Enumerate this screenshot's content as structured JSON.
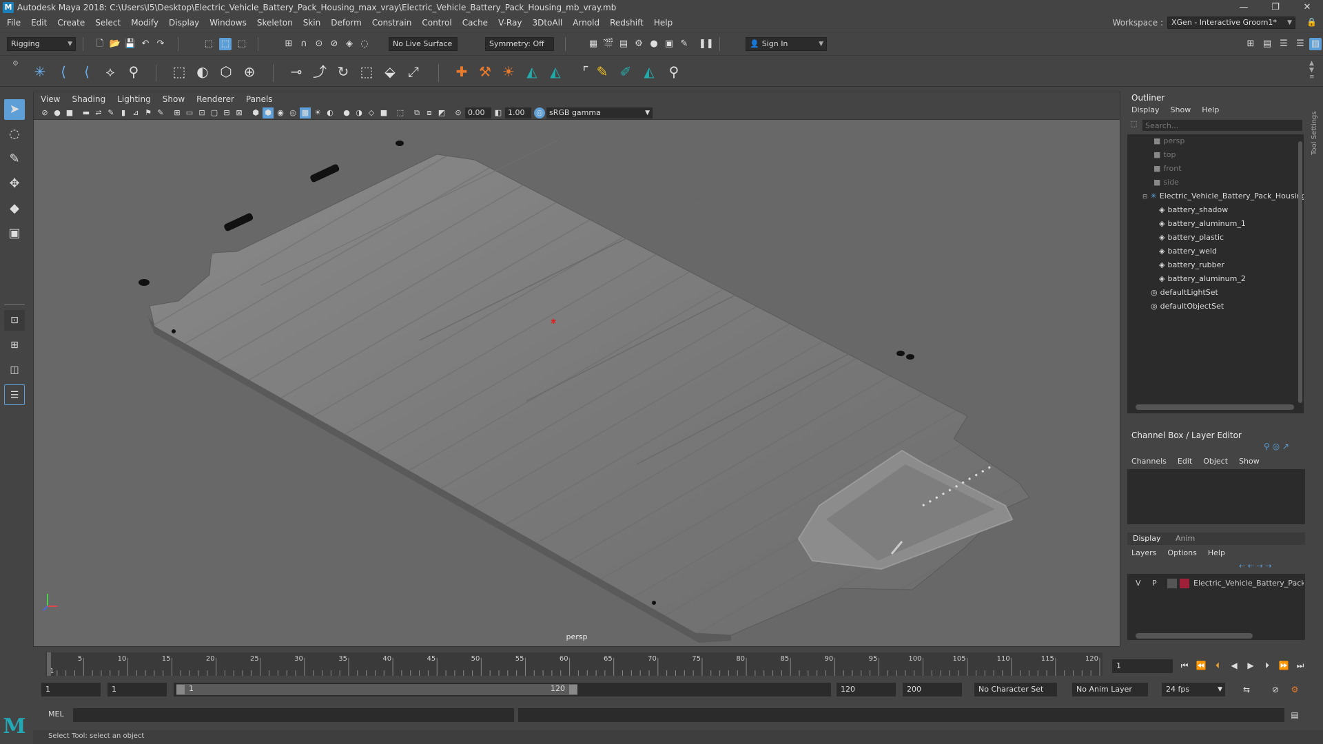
{
  "window": {
    "title": "Autodesk Maya 2018: C:\\Users\\I5\\Desktop\\Electric_Vehicle_Battery_Pack_Housing_max_vray\\Electric_Vehicle_Battery_Pack_Housing_mb_vray.mb",
    "app_icon": "M"
  },
  "menubar": [
    "File",
    "Edit",
    "Create",
    "Select",
    "Modify",
    "Display",
    "Windows",
    "Skeleton",
    "Skin",
    "Deform",
    "Constrain",
    "Control",
    "Cache",
    "V-Ray",
    "3DtoAll",
    "Arnold",
    "Redshift",
    "Help"
  ],
  "workspace": {
    "label": "Workspace :",
    "value": "XGen - Interactive Groom1*"
  },
  "statusline": {
    "mode": "Rigging",
    "live_surface": "No Live Surface",
    "symmetry": "Symmetry: Off",
    "sign_in": "Sign In"
  },
  "viewport": {
    "menus": [
      "View",
      "Shading",
      "Lighting",
      "Show",
      "Renderer",
      "Panels"
    ],
    "exposure": "0.00",
    "gamma": "1.00",
    "colorspace": "sRGB gamma",
    "camera": "persp"
  },
  "outliner": {
    "title": "Outliner",
    "menus": [
      "Display",
      "Show",
      "Help"
    ],
    "search_placeholder": "Search...",
    "items": [
      {
        "label": "persp",
        "type": "camera",
        "dim": true,
        "indent": 1
      },
      {
        "label": "top",
        "type": "camera",
        "dim": true,
        "indent": 1
      },
      {
        "label": "front",
        "type": "camera",
        "dim": true,
        "indent": 1
      },
      {
        "label": "side",
        "type": "camera",
        "dim": true,
        "indent": 1
      },
      {
        "label": "Electric_Vehicle_Battery_Pack_Housing",
        "type": "group",
        "dim": false,
        "indent": 0
      },
      {
        "label": "battery_shadow",
        "type": "mesh",
        "dim": false,
        "indent": 2
      },
      {
        "label": "battery_aluminum_1",
        "type": "mesh",
        "dim": false,
        "indent": 2
      },
      {
        "label": "battery_plastic",
        "type": "mesh",
        "dim": false,
        "indent": 2
      },
      {
        "label": "battery_weld",
        "type": "mesh",
        "dim": false,
        "indent": 2
      },
      {
        "label": "battery_rubber",
        "type": "mesh",
        "dim": false,
        "indent": 2
      },
      {
        "label": "battery_aluminum_2",
        "type": "mesh",
        "dim": false,
        "indent": 2
      },
      {
        "label": "defaultLightSet",
        "type": "set",
        "dim": false,
        "indent": 1
      },
      {
        "label": "defaultObjectSet",
        "type": "set",
        "dim": false,
        "indent": 1
      }
    ]
  },
  "channelbox": {
    "title": "Channel Box / Layer Editor",
    "menus": [
      "Channels",
      "Edit",
      "Object",
      "Show"
    ],
    "tabs": [
      "Display",
      "Anim"
    ],
    "layer_menus": [
      "Layers",
      "Options",
      "Help"
    ],
    "layer": {
      "v": "V",
      "p": "P",
      "name": "Electric_Vehicle_Battery_Pack_Ho",
      "color": "#a0203a"
    }
  },
  "timeline": {
    "ticks": [
      "1",
      "5",
      "10",
      "15",
      "20",
      "25",
      "30",
      "35",
      "40",
      "45",
      "50",
      "55",
      "60",
      "65",
      "70",
      "75",
      "80",
      "85",
      "90",
      "95",
      "100",
      "105",
      "110",
      "115",
      "120"
    ],
    "current_frame": "1"
  },
  "range": {
    "start": "1",
    "playback_start": "1",
    "slider_start": "1",
    "slider_end": "120",
    "playback_end": "120",
    "end": "200",
    "character_set": "No Character Set",
    "anim_layer": "No Anim Layer",
    "fps": "24 fps"
  },
  "cmdline": {
    "label": "MEL"
  },
  "helpline": {
    "text": "Select Tool: select an object"
  },
  "colors": {
    "accent": "#5d9fd6",
    "panel": "#444444",
    "field": "#2b2b2b",
    "viewport_bg": "#686868"
  }
}
